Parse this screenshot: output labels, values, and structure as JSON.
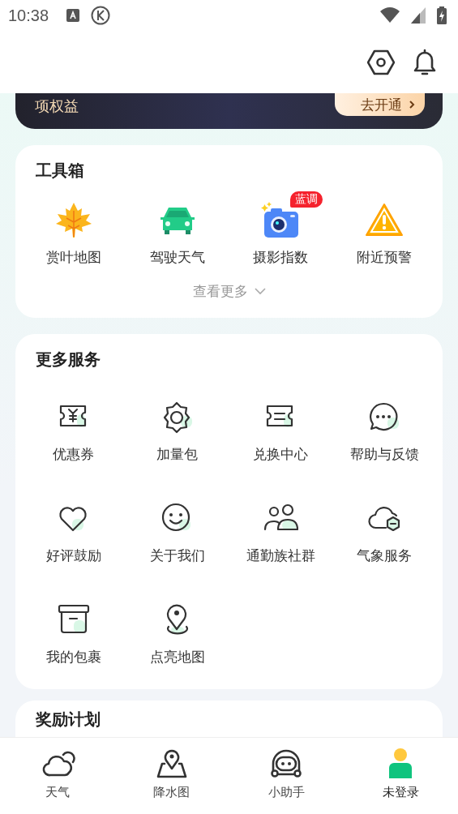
{
  "status_bar": {
    "time": "10:38"
  },
  "vip_banner": {
    "text": "项权益",
    "button": "去开通"
  },
  "toolbox": {
    "title": "工具箱",
    "items": [
      {
        "kind": "leaf",
        "label": "赏叶地图"
      },
      {
        "kind": "car",
        "label": "驾驶天气"
      },
      {
        "kind": "camera",
        "label": "摄影指数",
        "badge": "蓝调"
      },
      {
        "kind": "warning",
        "label": "附近预警"
      }
    ],
    "more": "查看更多"
  },
  "services": {
    "title": "更多服务",
    "items": [
      {
        "kind": "coupon",
        "label": "优惠券"
      },
      {
        "kind": "gear",
        "label": "加量包"
      },
      {
        "kind": "ticket",
        "label": "兑换中心"
      },
      {
        "kind": "chat",
        "label": "帮助与反馈"
      },
      {
        "kind": "heart",
        "label": "好评鼓励"
      },
      {
        "kind": "smile",
        "label": "关于我们"
      },
      {
        "kind": "people",
        "label": "通勤族社群"
      },
      {
        "kind": "cloud",
        "label": "气象服务"
      },
      {
        "kind": "box",
        "label": "我的包裹"
      },
      {
        "kind": "pin",
        "label": "点亮地图"
      }
    ]
  },
  "rewards": {
    "title": "奖励计划"
  },
  "tab_bar": [
    {
      "kind": "weather",
      "label": "天气",
      "selected": false
    },
    {
      "kind": "map",
      "label": "降水图",
      "selected": false
    },
    {
      "kind": "robot",
      "label": "小助手",
      "selected": false
    },
    {
      "kind": "user",
      "label": "未登录",
      "selected": true
    }
  ]
}
